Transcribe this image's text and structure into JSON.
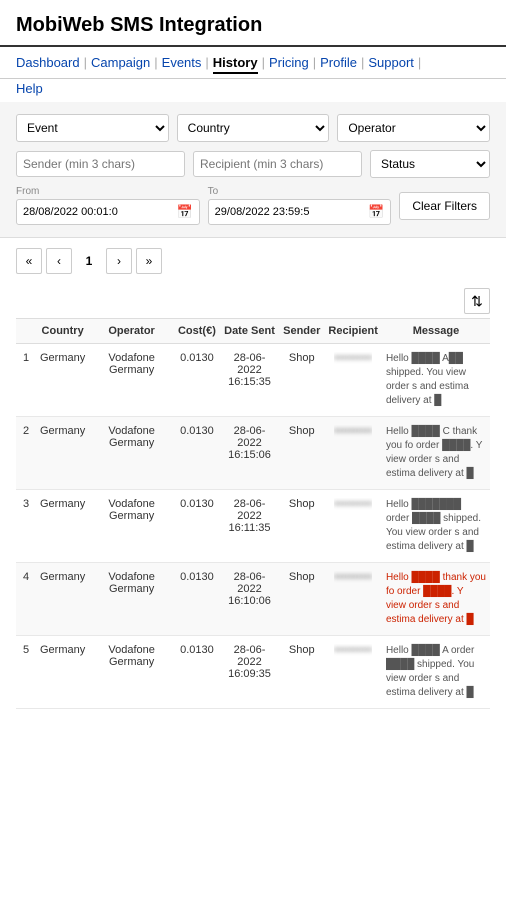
{
  "header": {
    "title": "MobiWeb SMS Integration"
  },
  "nav": {
    "items": [
      {
        "label": "Dashboard",
        "active": false
      },
      {
        "label": "Campaign",
        "active": false
      },
      {
        "label": "Events",
        "active": false
      },
      {
        "label": "History",
        "active": true
      },
      {
        "label": "Pricing",
        "active": false
      },
      {
        "label": "Profile",
        "active": false
      },
      {
        "label": "Support",
        "active": false
      }
    ],
    "second_row": [
      "Help"
    ]
  },
  "filters": {
    "event_placeholder": "Event",
    "country_placeholder": "Country",
    "operator_placeholder": "Operator",
    "sender_placeholder": "Sender (min 3 chars)",
    "recipient_placeholder": "Recipient (min 3 chars)",
    "status_placeholder": "Status",
    "from_label": "From",
    "from_value": "28/08/2022 00:01:0",
    "to_label": "To",
    "to_value": "29/08/2022 23:59:5",
    "clear_label": "Clear Filters"
  },
  "pagination": {
    "first_label": "«",
    "prev_label": "‹",
    "current": "1",
    "next_label": "›",
    "last_label": "»"
  },
  "table": {
    "columns": [
      "",
      "Country",
      "Operator",
      "Cost(€)",
      "Date Sent",
      "Sender",
      "Recipient",
      "Message"
    ],
    "rows": [
      {
        "num": "1",
        "country": "Germany",
        "operator": "Vodafone Germany",
        "cost": "0.0130",
        "date": "28-06-2022 16:15:35",
        "sender": "Shop",
        "recipient_blurred": "••••••••••",
        "message": "Hello ████ A██ shipped. You view order s and estima delivery at █",
        "message_color": "normal"
      },
      {
        "num": "2",
        "country": "Germany",
        "operator": "Vodafone Germany",
        "cost": "0.0130",
        "date": "28-06-2022 16:15:06",
        "sender": "Shop",
        "recipient_blurred": "••••••••••",
        "message": "Hello ████ C thank you fo order ████. Y view order s and estima delivery at █",
        "message_color": "normal"
      },
      {
        "num": "3",
        "country": "Germany",
        "operator": "Vodafone Germany",
        "cost": "0.0130",
        "date": "28-06-2022 16:11:35",
        "sender": "Shop",
        "recipient_blurred": "••••••••••",
        "message": "Hello ███████ order ████ shipped. You view order s and estima delivery at █",
        "message_color": "normal"
      },
      {
        "num": "4",
        "country": "Germany",
        "operator": "Vodafone Germany",
        "cost": "0.0130",
        "date": "28-06-2022 16:10:06",
        "sender": "Shop",
        "recipient_blurred": "••••••••••",
        "message": "Hello ████ thank you fo order ████. Y view order s and estima delivery at █",
        "message_color": "red"
      },
      {
        "num": "5",
        "country": "Germany",
        "operator": "Vodafone Germany",
        "cost": "0.0130",
        "date": "28-06-2022 16:09:35",
        "sender": "Shop",
        "recipient_blurred": "••••••••••",
        "message": "Hello ████ A order ████ shipped. You view order s and estima delivery at █",
        "message_color": "normal"
      }
    ]
  }
}
